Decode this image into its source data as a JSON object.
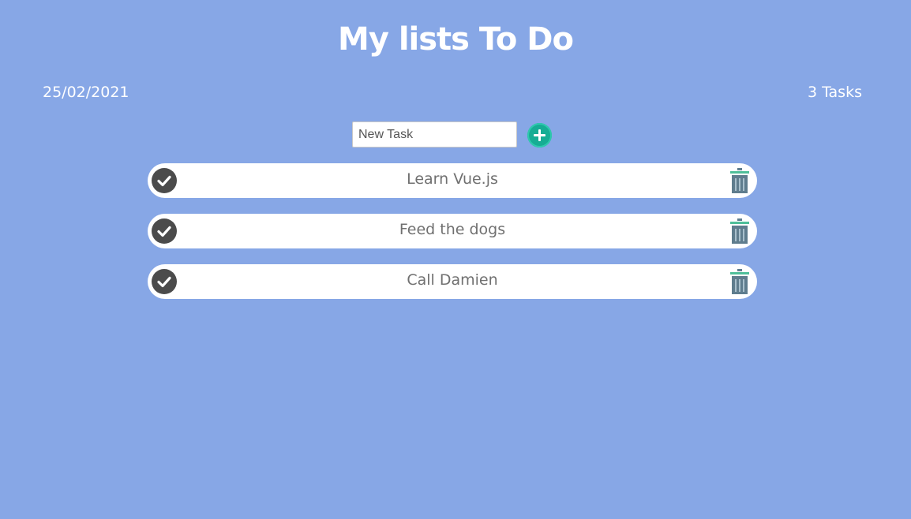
{
  "header": {
    "title": "My lists To Do",
    "date": "25/02/2021",
    "task_count": "3 Tasks"
  },
  "new_task": {
    "placeholder": "New Task",
    "add_icon": "plus-circle-icon",
    "add_color": "#16ad94"
  },
  "todos": [
    {
      "text": "Learn Vue.js",
      "check_icon": "check-circle-icon",
      "delete_icon": "trash-icon"
    },
    {
      "text": "Feed the dogs",
      "check_icon": "check-circle-icon",
      "delete_icon": "trash-icon"
    },
    {
      "text": "Call Damien",
      "check_icon": "check-circle-icon",
      "delete_icon": "trash-icon"
    }
  ],
  "colors": {
    "background": "#87a7e6",
    "item_background": "#ffffff",
    "item_text": "#707070",
    "check_circle": "#4b4b4b",
    "trash_body": "#5f7d8e",
    "trash_lid": "#4fbf9a"
  }
}
